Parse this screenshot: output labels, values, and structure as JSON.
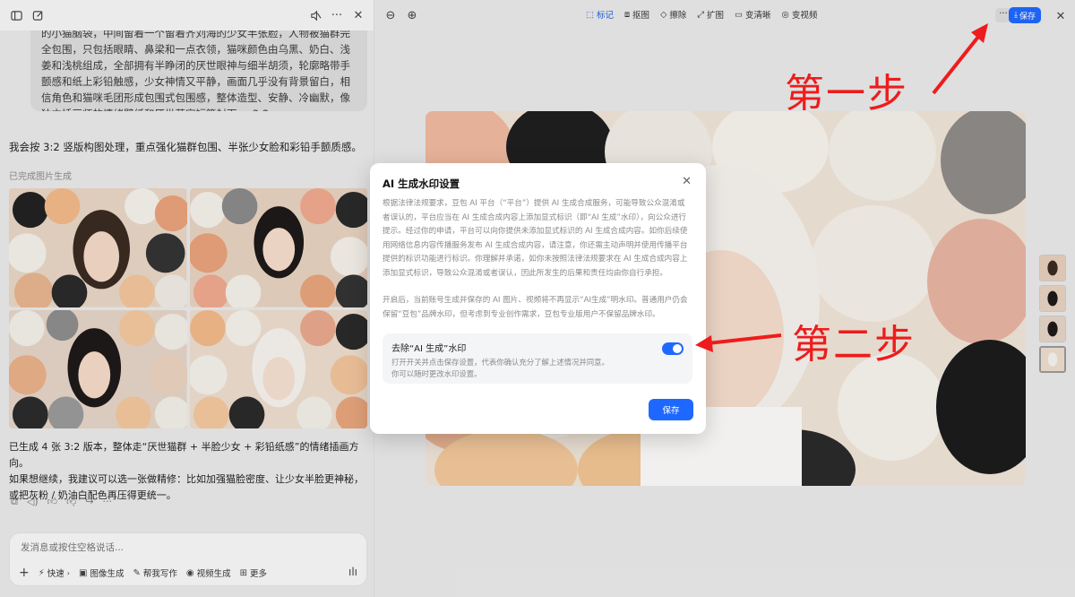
{
  "left_panel": {
    "prompt_text": "的小猫脑袋，中间留着一个留着齐刘海的少女半张脸，人物被猫群完全包围，只包括眼睛、鼻梁和一点衣领，猫咪颜色由乌黑、奶白、浅姜和浅桃组成，全部拥有半睁闭的厌世眼神与细半胡须，轮廓略带手颤感和纸上彩铅触感，少女神情又平静，画面几乎没有背景留白，相信角色和猫咪毛团形成包围式包围感，整体造型、安静、冷幽默，像独立插画师的情绪壁纸和厌世萌宠短篇封面。，3:2",
    "ai_reply": "我会按 3:2 竖版构图处理，重点强化猫群包围、半张少女脸和彩铅手颤质感。",
    "gen_status": "已完成图片生成",
    "summary_line1": "已生成 4 张 3:2 版本，整体走“厌世猫群 + 半脸少女 + 彩铅纸感”的情绪插画方向。",
    "summary_line2": "如果想继续，我建议可以选一张做精修：比如加强猫脸密度、让少女半脸更神秘，或把灰粉 / 奶油白配色再压得更统一。",
    "composer_placeholder": "发消息或按住空格说话...",
    "tools": {
      "add": "+",
      "fast": "快速",
      "image_gen": "图像生成",
      "writing": "帮我写作",
      "video_gen": "视频生成",
      "more": "更多"
    }
  },
  "right_panel": {
    "edit_tools": [
      "标记",
      "抠图",
      "擦除",
      "扩图",
      "变清晰",
      "变视频"
    ],
    "more_label": "···",
    "save_label": "保存"
  },
  "modal": {
    "title": "AI 生成水印设置",
    "para1": "根据法律法规要求，豆包 AI 平台（“平台”）提供 AI 生成合成服务，可能导致公众混淆或者误认的，平台应当在 AI 生成合成内容上添加显式标识（即“AI 生成”水印），向公众进行提示。经过你的申请，平台可以向你提供未添加显式标识的 AI 生成合成内容。如你后续使用网络信息内容传播服务发布 AI 生成合成内容，请注意，你还需主动声明并使用传播平台提供的标识功能进行标识。你理解并承诺，如你未按照法律法规要求在 AI 生成合成内容上添加显式标识，导致公众混淆或者误认，因此所发生的后果和责任均由你自行承担。",
    "para2": "开启后，当前账号生成并保存的 AI 图片、视频将不再显示“AI生成”明水印。普通用户仍会保留“豆包”品牌水印，但考虑到专业创作需求，豆包专业版用户不保留品牌水印。",
    "toggle_title": "去除“AI 生成”水印",
    "toggle_desc1": "打开开关并点击保存设置，代表你确认充分了解上述情况并同意。",
    "toggle_desc2": "你可以随时更改水印设置。",
    "toggle_on": true,
    "save_label": "保存"
  },
  "annotations": {
    "step1": "第一步",
    "step2": "第二步",
    "color": "#ee1c1c"
  },
  "colors": {
    "accent": "#1f68ff"
  }
}
